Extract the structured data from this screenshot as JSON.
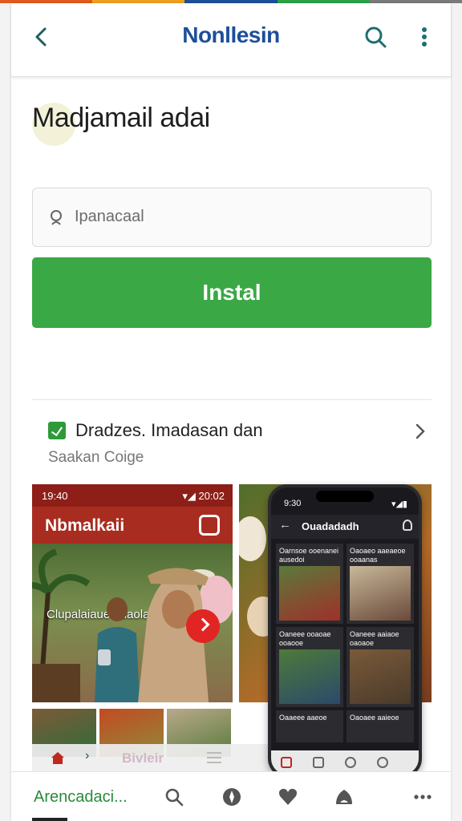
{
  "colors": {
    "top_stripe": [
      "#e25a1c",
      "#f0a020",
      "#1d4f9a",
      "#2aa347",
      "#7a7a7a"
    ],
    "title_blue": "#1d4f9a",
    "install_green": "#3aa845",
    "nav_green": "#2a8a3a"
  },
  "topbar": {
    "back_icon": "back-arrow-icon",
    "title": "Nonllesin",
    "search_icon": "search-icon",
    "more_icon": "more-vertical-icon"
  },
  "app": {
    "name": "Madjamail adai"
  },
  "search": {
    "placeholder": "Ipanacaal"
  },
  "install": {
    "label": "Instal"
  },
  "section": {
    "title": "Dradzes. Imadasan dan",
    "subtitle": "Saakan Coige"
  },
  "screenshot1": {
    "status_time": "19:40",
    "status_right": "▾◢ 20:02",
    "header_name": "Nbmalkaii",
    "caption": "Clupalaiaue odaolatadn"
  },
  "screenshot2": {
    "status_time": "9:30",
    "status_right": "▾◢▮",
    "header_title": "Ouadadadh",
    "tiles": [
      {
        "label": "Oarnsoe ooenanei ausedoi"
      },
      {
        "label": "Oaoaeo aaeaeoe ooaanas"
      },
      {
        "label": "Oaneee ooaoae ooaooe"
      },
      {
        "label": "Oaneee aaiaoe oaoaoe"
      },
      {
        "label": "Oaaeee aaeoe"
      },
      {
        "label": "Oaoaee aaieoe"
      }
    ]
  },
  "mini_nav": {
    "label": "Bivleir",
    "chevron": "›"
  },
  "bottom_nav": {
    "label": "Arencadaci...",
    "items": [
      "search-icon",
      "compass-icon",
      "heart-icon",
      "profile-icon",
      "more-horizontal-icon"
    ]
  }
}
